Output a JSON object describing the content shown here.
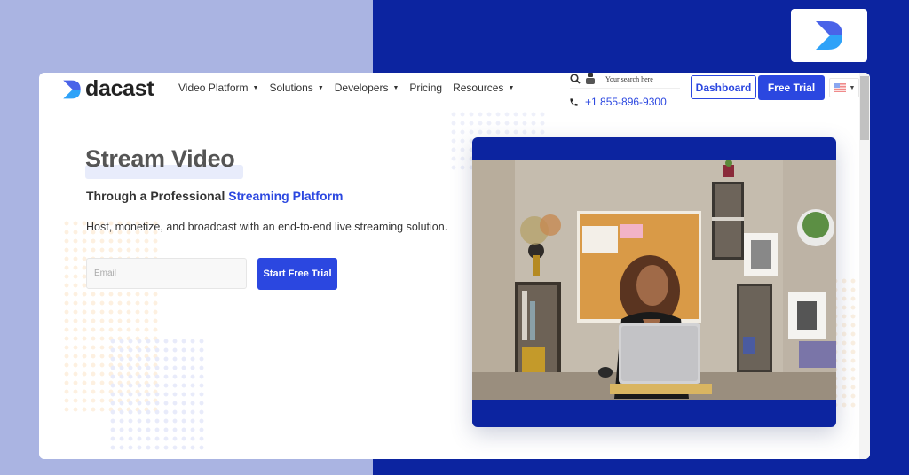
{
  "brand": {
    "name": "dacast",
    "primary_color": "#2b47e0",
    "dark_blue": "#0c24a0",
    "light_blue": "#aab4e2"
  },
  "nav": {
    "items": [
      {
        "label": "Video Platform",
        "has_dropdown": true
      },
      {
        "label": "Solutions",
        "has_dropdown": true
      },
      {
        "label": "Developers",
        "has_dropdown": true
      },
      {
        "label": "Pricing",
        "has_dropdown": false
      },
      {
        "label": "Resources",
        "has_dropdown": true
      }
    ],
    "search_placeholder": "Your search here",
    "phone": "+1 855-896-9300",
    "dashboard_label": "Dashboard",
    "free_trial_label": "Free Trial",
    "language": "en-US"
  },
  "hero": {
    "title": "Stream Video",
    "subtitle_prefix": "Through a Professional ",
    "subtitle_accent": "Streaming Platform",
    "description": "Host, monetize, and broadcast with an end-to-end live streaming solution.",
    "email_placeholder": "Email",
    "cta_label": "Start Free Trial"
  },
  "video": {
    "description": "Woman smiling at laptop in home office"
  },
  "icons": {
    "caret": "▾",
    "search": "search-icon",
    "phone": "phone-icon"
  }
}
